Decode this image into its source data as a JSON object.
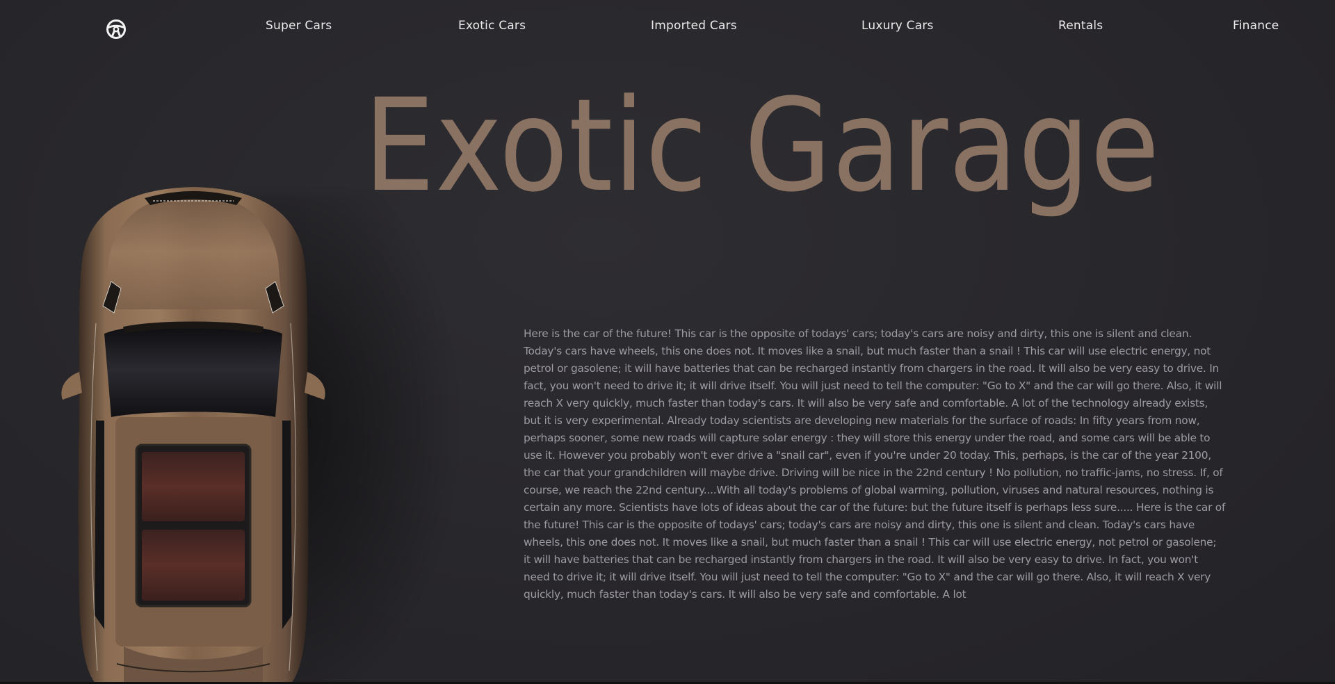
{
  "nav": {
    "logo_icon": "steering-wheel-icon",
    "links": [
      {
        "label": "Super Cars"
      },
      {
        "label": "Exotic Cars"
      },
      {
        "label": "Imported Cars"
      },
      {
        "label": "Luxury Cars"
      },
      {
        "label": "Rentals"
      },
      {
        "label": "Finance"
      }
    ]
  },
  "hero": {
    "title": "Exotic Garage",
    "title_color": "#8a7262"
  },
  "car_image": {
    "icon": "car-top-view-image",
    "color": "#7a5f48"
  },
  "article": {
    "text": "Here is the car of the future! This car is the opposite of todays' cars; today's cars are noisy and dirty, this one is silent and clean. Today's cars have wheels, this one does not. It moves like a snail, but much faster than a snail ! This car will use electric energy, not petrol or gasolene; it will have batteries that can be recharged instantly from chargers in the road. It will also be very easy to drive. In fact, you won't need to drive it; it will drive itself. You will just need to tell the computer: \"Go to X\" and the car will go there. Also, it will reach X very quickly, much faster than today's cars. It will also be very safe and comfortable. A lot of the technology already exists, but it is very experimental. Already today scientists are developing new materials for the surface of roads: In fifty years from now, perhaps sooner, some new roads will capture solar energy : they will store this energy under the road, and some cars will be able to use it. However you probably won't ever drive a \"snail car\", even if you're under 20 today. This, perhaps, is the car of the year 2100, the car that your grandchildren will maybe drive. Driving will be nice in the 22nd century ! No pollution, no traffic-jams, no stress. If, of course, we reach the 22nd century....With all today's problems of global warming, pollution, viruses and natural resources, nothing is certain any more. Scientists have lots of ideas about the car of the future: but the future itself is perhaps less sure..... Here is the car of the future! This car is the opposite of todays' cars; today's cars are noisy and dirty, this one is silent and clean. Today's cars have wheels, this one does not. It moves like a snail, but much faster than a snail ! This car will use electric energy, not petrol or gasolene; it will have batteries that can be recharged instantly from chargers in the road. It will also be very easy to drive. In fact, you won't need to drive it; it will drive itself. You will just need to tell the computer: \"Go to X\" and the car will go there. Also, it will reach X very quickly, much faster than today's cars. It will also be very safe and comfortable. A lot"
  }
}
